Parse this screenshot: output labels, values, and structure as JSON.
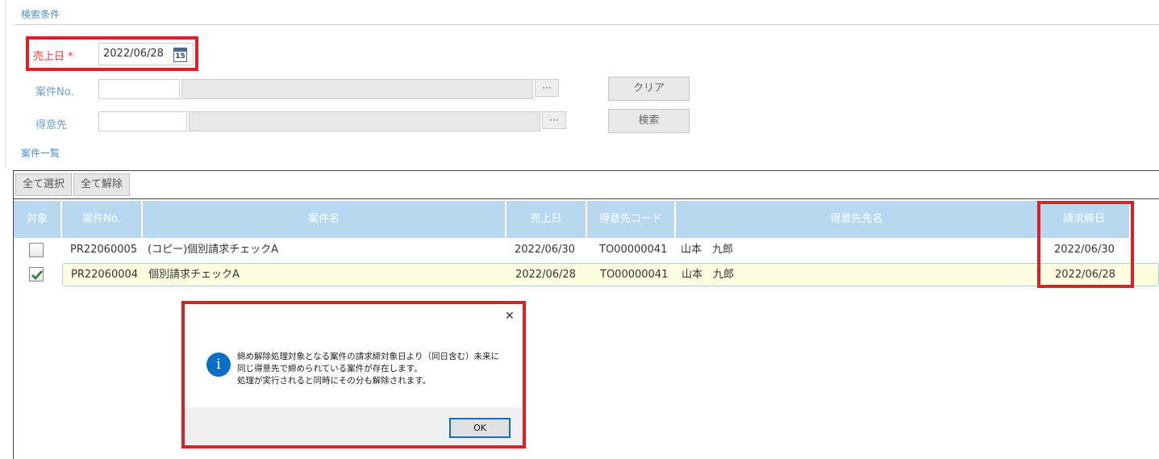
{
  "search": {
    "section_title": "検索条件",
    "uriage_label": "売上日",
    "required_mark": "*",
    "uriage_value": "2022/06/28",
    "calendar_day": "15",
    "anken_label": "案件No.",
    "tokuisaki_label": "得意先",
    "clear_label": "クリア",
    "search_label": "検索",
    "dots": "···"
  },
  "list": {
    "section_title": "案件一覧",
    "select_all": "全て選択",
    "clear_all": "全て解除",
    "headers": {
      "target": "対象",
      "anken_no": "案件No.",
      "anken_name": "案件名",
      "uriage": "売上日",
      "code": "得意先コード",
      "tokuisaki_name": "得意先先名",
      "seikyu": "請求締日"
    },
    "rows": [
      {
        "checked": false,
        "anken_no": "PR22060005",
        "anken_name": "(コピー)個別請求チェックA",
        "uriage": "2022/06/30",
        "code": "TO00000041",
        "tokuisaki_name": "山本　九郎",
        "seikyu": "2022/06/30"
      },
      {
        "checked": true,
        "anken_no": "PR22060004",
        "anken_name": "個別請求チェックA",
        "uriage": "2022/06/28",
        "code": "TO00000041",
        "tokuisaki_name": "山本　九郎",
        "seikyu": "2022/06/28"
      }
    ]
  },
  "dialog": {
    "close": "✕",
    "info_symbol": "i",
    "line1": "締め解除処理対象となる案件の請求締対象日より（同日含む）未来に",
    "line2": "同じ得意先で締められている案件が存在します。",
    "line3": "処理が実行されると同時にその分も解除されます。",
    "ok_label": "OK"
  },
  "colors": {
    "accent_blue": "#4a90c8",
    "header_blue": "#b7d8ef",
    "highlight_red": "#e01e25",
    "selected_row": "#fdfde0"
  }
}
